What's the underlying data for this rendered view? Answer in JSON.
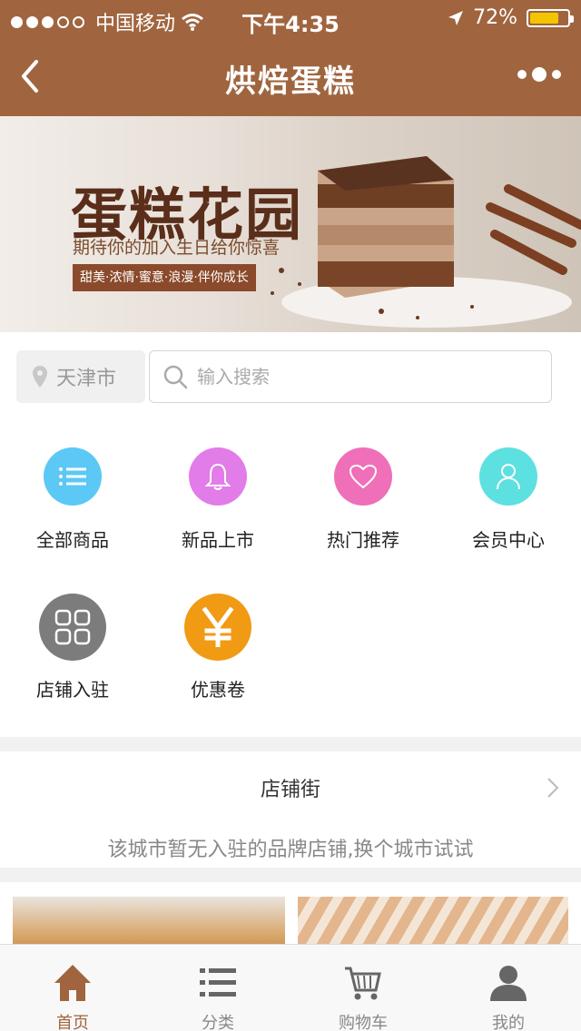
{
  "status_bar": {
    "carrier": "中国移动",
    "time": "下午4:35",
    "battery": "72%"
  },
  "nav": {
    "title": "烘焙蛋糕"
  },
  "banner": {
    "title": "蛋糕花园",
    "subtitle": "期待你的加入生日给你惊喜",
    "tagline": "甜美·浓情·蜜意·浪漫·伴你成长"
  },
  "search": {
    "city": "天津市",
    "placeholder": "输入搜索"
  },
  "menu": [
    {
      "label": "全部商品",
      "icon": "list-icon",
      "color": "#5bc8f5"
    },
    {
      "label": "新品上市",
      "icon": "bell-icon",
      "color": "#e27ce8"
    },
    {
      "label": "热门推荐",
      "icon": "heart-icon",
      "color": "#ef6fb8"
    },
    {
      "label": "会员中心",
      "icon": "user-icon",
      "color": "#5de0e0"
    },
    {
      "label": "店铺入驻",
      "icon": "grid-icon",
      "color": "#7c7c7c"
    },
    {
      "label": "优惠卷",
      "icon": "yen-icon",
      "color": "#f19a14"
    }
  ],
  "shop_street": {
    "title": "店铺街",
    "message": "该城市暂无入驻的品牌店铺,换个城市试试"
  },
  "tabs": [
    {
      "label": "首页",
      "icon": "home-icon"
    },
    {
      "label": "分类",
      "icon": "category-list-icon"
    },
    {
      "label": "购物车",
      "icon": "cart-icon"
    },
    {
      "label": "我的",
      "icon": "profile-icon"
    }
  ],
  "colors": {
    "brand": "#a0653f",
    "active_tab": "#a0653f",
    "battery_fill": "#f4c400"
  }
}
